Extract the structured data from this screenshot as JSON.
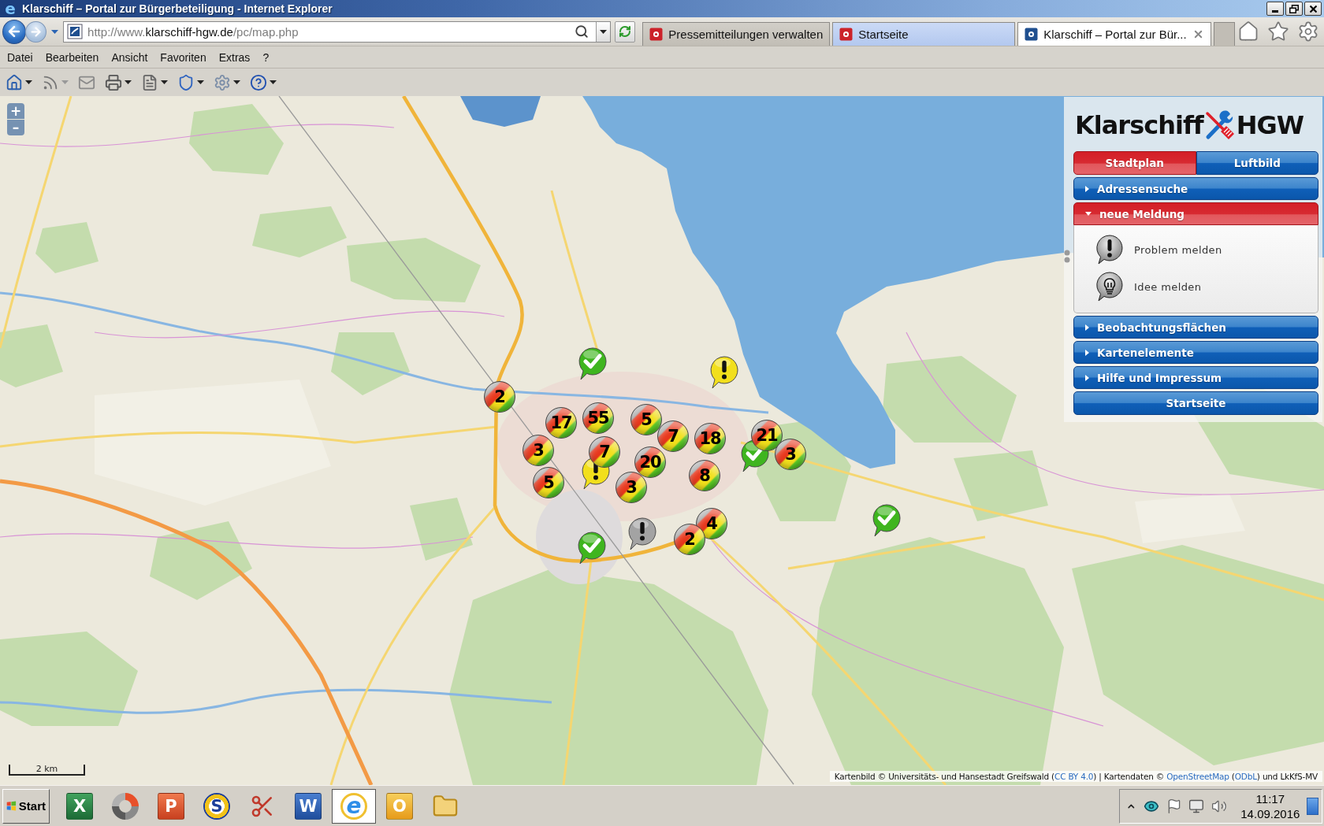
{
  "window": {
    "icon_letter": "e",
    "title": "Klarschiff – Portal zur Bürgerbeteiligung - Internet Explorer"
  },
  "address_bar": {
    "url_prefix": "http://www.",
    "url_domain": "klarschiff-hgw.de",
    "url_path": "/pc/map.php"
  },
  "tabs": [
    {
      "label": "Pressemitteilungen verwalten",
      "selected": false,
      "hovered": false,
      "color": "#cc2229"
    },
    {
      "label": "Startseite",
      "selected": false,
      "hovered": true,
      "color": "#cc2229"
    },
    {
      "label": "Klarschiff – Portal zur Bür...",
      "selected": true,
      "hovered": false,
      "color": "#1f4f8f"
    }
  ],
  "menu": [
    "Datei",
    "Bearbeiten",
    "Ansicht",
    "Favoriten",
    "Extras",
    "?"
  ],
  "map": {
    "zoom_in": "+",
    "zoom_out": "–",
    "scale": "2 km",
    "markers": [
      {
        "kind": "check",
        "color": "#3fb51f"
      },
      {
        "kind": "alert",
        "color": "#f2df1c"
      },
      {
        "kind": "cluster",
        "count": "2"
      },
      {
        "kind": "cluster",
        "count": "17"
      },
      {
        "kind": "cluster",
        "count": "55"
      },
      {
        "kind": "cluster",
        "count": "5"
      },
      {
        "kind": "cluster",
        "count": "3"
      },
      {
        "kind": "cluster",
        "count": "7"
      },
      {
        "kind": "cluster",
        "count": "7"
      },
      {
        "kind": "cluster",
        "count": "18"
      },
      {
        "kind": "cluster",
        "count": "21"
      },
      {
        "kind": "cluster",
        "count": "5"
      },
      {
        "kind": "alert",
        "color": "#f2df1c"
      },
      {
        "kind": "cluster",
        "count": "20"
      },
      {
        "kind": "check",
        "color": "#3fb51f"
      },
      {
        "kind": "cluster",
        "count": "3"
      },
      {
        "kind": "cluster",
        "count": "3"
      },
      {
        "kind": "cluster",
        "count": "8"
      },
      {
        "kind": "check",
        "color": "#3fb51f"
      },
      {
        "kind": "alert",
        "color": "#a3a3a3"
      },
      {
        "kind": "cluster",
        "count": "2"
      },
      {
        "kind": "cluster",
        "count": "4"
      },
      {
        "kind": "check",
        "color": "#3fb51f"
      }
    ],
    "attribution": [
      {
        "kind": "text",
        "text": "Kartenbild © Universitäts- und Hansestadt Greifswald ("
      },
      {
        "kind": "link",
        "text": "CC BY 4.0"
      },
      {
        "kind": "text",
        "text": ") | Kartendaten © "
      },
      {
        "kind": "link",
        "text": "OpenStreetMap"
      },
      {
        "kind": "text",
        "text": " ("
      },
      {
        "kind": "link",
        "text": "ODbL"
      },
      {
        "kind": "text",
        "text": ") und LkKfS-MV"
      }
    ]
  },
  "panel": {
    "logo_left": "Klarschiff",
    "logo_right": "HGW",
    "views": [
      {
        "label": "Stadtplan",
        "selected": true
      },
      {
        "label": "Luftbild",
        "selected": false
      }
    ],
    "sections": [
      {
        "title": "Adressensuche",
        "expanded": false
      },
      {
        "title": "neue Meldung",
        "expanded": true,
        "items": [
          {
            "kind": "problem",
            "label": "Problem melden"
          },
          {
            "kind": "idea",
            "label": "Idee melden"
          }
        ]
      },
      {
        "title": "Beobachtungsflächen",
        "expanded": false
      },
      {
        "title": "Kartenelemente",
        "expanded": false
      },
      {
        "title": "Hilfe und Impressum",
        "expanded": false
      }
    ],
    "home_button": "Startseite"
  },
  "taskbar": {
    "start": "Start",
    "apps": [
      {
        "kind": "sheet",
        "letter": "X",
        "selected": false
      },
      {
        "kind": "aperture",
        "selected": false
      },
      {
        "kind": "slides",
        "letter": "P",
        "selected": false
      },
      {
        "kind": "ring",
        "letter": "S",
        "selected": false
      },
      {
        "kind": "scissors",
        "selected": false
      },
      {
        "kind": "doc",
        "letter": "W",
        "selected": false
      },
      {
        "kind": "browser",
        "letter": "e",
        "selected": true
      },
      {
        "kind": "mail",
        "letter": "O",
        "selected": false
      },
      {
        "kind": "folder",
        "selected": false
      }
    ],
    "time": "11:17",
    "date": "14.09.2016"
  }
}
